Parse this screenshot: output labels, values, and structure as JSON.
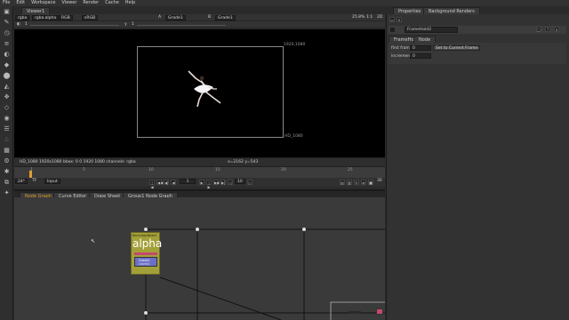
{
  "menu": [
    "File",
    "Edit",
    "Workspace",
    "Viewer",
    "Render",
    "Cache",
    "Help"
  ],
  "viewer": {
    "tab": "Viewer1",
    "channels": "rgba",
    "layer": "rgba.alpha",
    "colorspace": "RGB",
    "proxy": "sRGB",
    "input_a": "A",
    "input_a_node": "Grade1",
    "input_b": "B",
    "input_b_node": "Grade1",
    "zoom": "25.8%",
    "ratio": "1:1",
    "mode": "2D",
    "gain_value": "1",
    "gamma_value": "1",
    "frame_top_right": "1920,1080",
    "frame_bottom_right": "HD_1080",
    "status_left": "HD_1080 1920x1080  bbox: 0 0 1920 1080 channels: rgba",
    "status_right": "x=2162 y=543"
  },
  "timeline": {
    "ticks": [
      "1",
      "5",
      "10",
      "15",
      "20",
      "25"
    ],
    "current_frame": "1",
    "end_frame": "30",
    "fps_label": "24*",
    "tf_label": "TF",
    "input_label": "Input",
    "step_value": "10"
  },
  "lower_tabs": [
    "Node Graph",
    "Curve Editor",
    "Dope Sheet",
    "Group1 Node Graph"
  ],
  "node_graph": {
    "backdrop_title": "BackdropNode1",
    "backdrop_label": "alpha",
    "inner_node": "Grade1",
    "inner_node_sub": "(alpha)"
  },
  "properties": {
    "tabs": [
      "Properties",
      "Background Renders"
    ],
    "node_name": "FrameHold2",
    "subtabs": [
      "FrameHold",
      "Node"
    ],
    "first_frame_label": "first frame",
    "first_frame_value": "0",
    "increment_label": "increment",
    "increment_value": "0",
    "set_button": "Set to Current Frame"
  },
  "colors": {
    "backdrop": "#a3a03a",
    "viewer_bg": "#000000",
    "graph_bg": "#3a3a3a",
    "accent_orange": "#e0a030",
    "node_pink": "#c24a6a"
  }
}
